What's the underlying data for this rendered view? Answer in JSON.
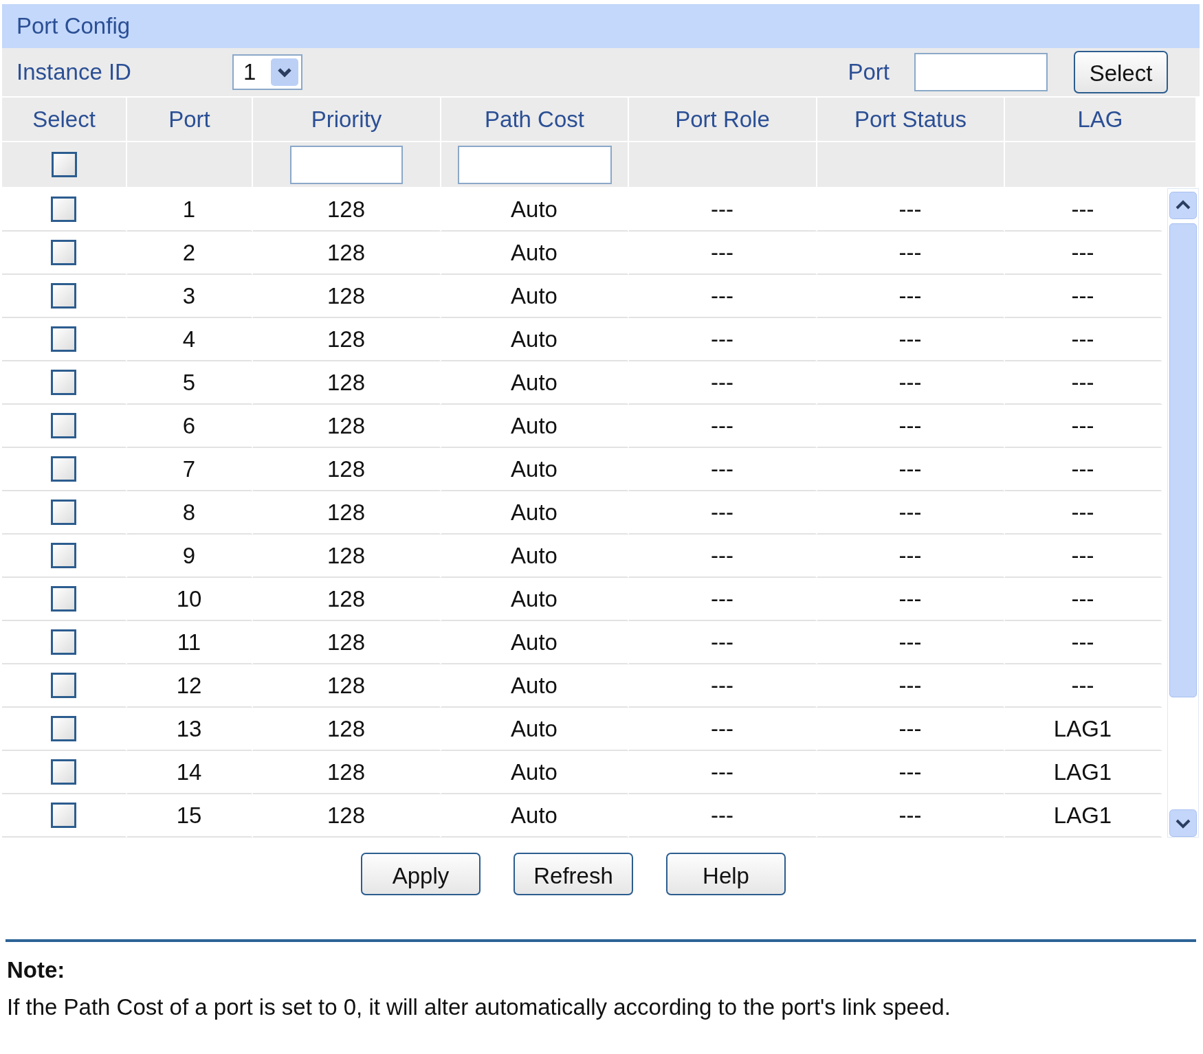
{
  "title": "Port Config",
  "instance": {
    "label": "Instance ID",
    "value": "1"
  },
  "port_filter": {
    "label": "Port",
    "button": "Select"
  },
  "table": {
    "columns": [
      "Select",
      "Port",
      "Priority",
      "Path Cost",
      "Port Role",
      "Port Status",
      "LAG"
    ],
    "select_all": {
      "checked": false
    },
    "rows": [
      {
        "checked": false,
        "port": "1",
        "priority": "128",
        "path_cost": "Auto",
        "role": "---",
        "status": "---",
        "lag": "---"
      },
      {
        "checked": false,
        "port": "2",
        "priority": "128",
        "path_cost": "Auto",
        "role": "---",
        "status": "---",
        "lag": "---"
      },
      {
        "checked": false,
        "port": "3",
        "priority": "128",
        "path_cost": "Auto",
        "role": "---",
        "status": "---",
        "lag": "---"
      },
      {
        "checked": false,
        "port": "4",
        "priority": "128",
        "path_cost": "Auto",
        "role": "---",
        "status": "---",
        "lag": "---"
      },
      {
        "checked": false,
        "port": "5",
        "priority": "128",
        "path_cost": "Auto",
        "role": "---",
        "status": "---",
        "lag": "---"
      },
      {
        "checked": false,
        "port": "6",
        "priority": "128",
        "path_cost": "Auto",
        "role": "---",
        "status": "---",
        "lag": "---"
      },
      {
        "checked": false,
        "port": "7",
        "priority": "128",
        "path_cost": "Auto",
        "role": "---",
        "status": "---",
        "lag": "---"
      },
      {
        "checked": false,
        "port": "8",
        "priority": "128",
        "path_cost": "Auto",
        "role": "---",
        "status": "---",
        "lag": "---"
      },
      {
        "checked": false,
        "port": "9",
        "priority": "128",
        "path_cost": "Auto",
        "role": "---",
        "status": "---",
        "lag": "---"
      },
      {
        "checked": false,
        "port": "10",
        "priority": "128",
        "path_cost": "Auto",
        "role": "---",
        "status": "---",
        "lag": "---"
      },
      {
        "checked": false,
        "port": "11",
        "priority": "128",
        "path_cost": "Auto",
        "role": "---",
        "status": "---",
        "lag": "---"
      },
      {
        "checked": false,
        "port": "12",
        "priority": "128",
        "path_cost": "Auto",
        "role": "---",
        "status": "---",
        "lag": "---"
      },
      {
        "checked": false,
        "port": "13",
        "priority": "128",
        "path_cost": "Auto",
        "role": "---",
        "status": "---",
        "lag": "LAG1"
      },
      {
        "checked": false,
        "port": "14",
        "priority": "128",
        "path_cost": "Auto",
        "role": "---",
        "status": "---",
        "lag": "LAG1"
      },
      {
        "checked": false,
        "port": "15",
        "priority": "128",
        "path_cost": "Auto",
        "role": "---",
        "status": "---",
        "lag": "LAG1"
      }
    ]
  },
  "buttons": [
    "Apply",
    "Refresh",
    "Help"
  ],
  "note": {
    "heading": "Note:",
    "text": "If the Path Cost of a port is set to 0, it will alter automatically according to the port's link speed."
  }
}
